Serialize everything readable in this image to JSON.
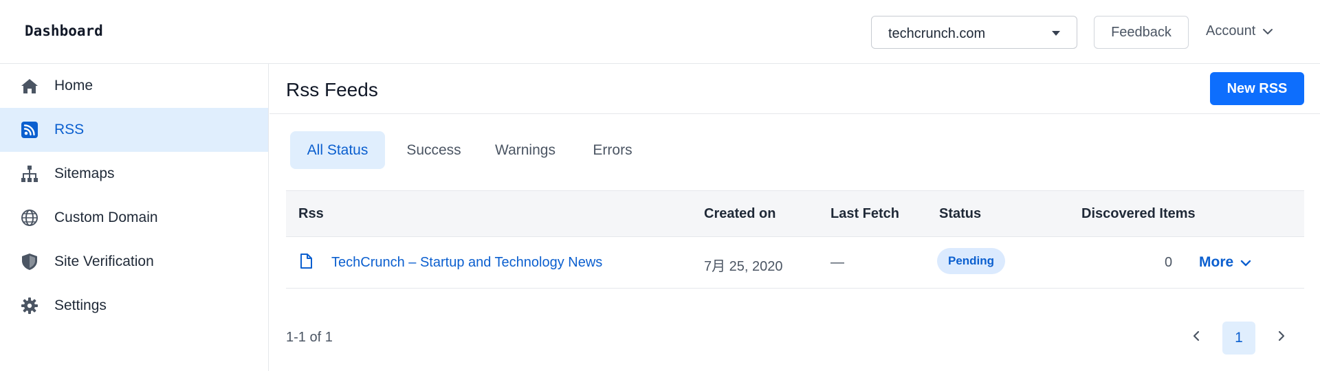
{
  "header": {
    "brand": "Dashboard",
    "domain_select": {
      "value": "techcrunch.com"
    },
    "feedback_label": "Feedback",
    "account_label": "Account"
  },
  "sidebar": {
    "items": [
      {
        "label": "Home",
        "icon": "home-icon"
      },
      {
        "label": "RSS",
        "icon": "rss-icon",
        "active": true
      },
      {
        "label": "Sitemaps",
        "icon": "sitemap-icon"
      },
      {
        "label": "Custom Domain",
        "icon": "globe-icon"
      },
      {
        "label": "Site Verification",
        "icon": "shield-icon"
      },
      {
        "label": "Settings",
        "icon": "gear-icon"
      }
    ]
  },
  "main": {
    "title": "Rss Feeds",
    "new_button": "New RSS",
    "tabs": [
      {
        "label": "All Status",
        "active": true
      },
      {
        "label": "Success"
      },
      {
        "label": "Warnings"
      },
      {
        "label": "Errors"
      }
    ],
    "table": {
      "columns": [
        "Rss",
        "Created on",
        "Last Fetch",
        "Status",
        "Discovered Items"
      ],
      "rows": [
        {
          "rss": "TechCrunch – Startup and Technology News",
          "created_on": "7月 25, 2020",
          "last_fetch": "—",
          "status": "Pending",
          "discovered_items": "0",
          "more_label": "More"
        }
      ]
    },
    "pagination": {
      "info": "1-1 of 1",
      "current_page": "1"
    }
  },
  "colors": {
    "accent": "#0d6efd",
    "active_bg": "#e0eefd",
    "link": "#0b5fcf"
  }
}
